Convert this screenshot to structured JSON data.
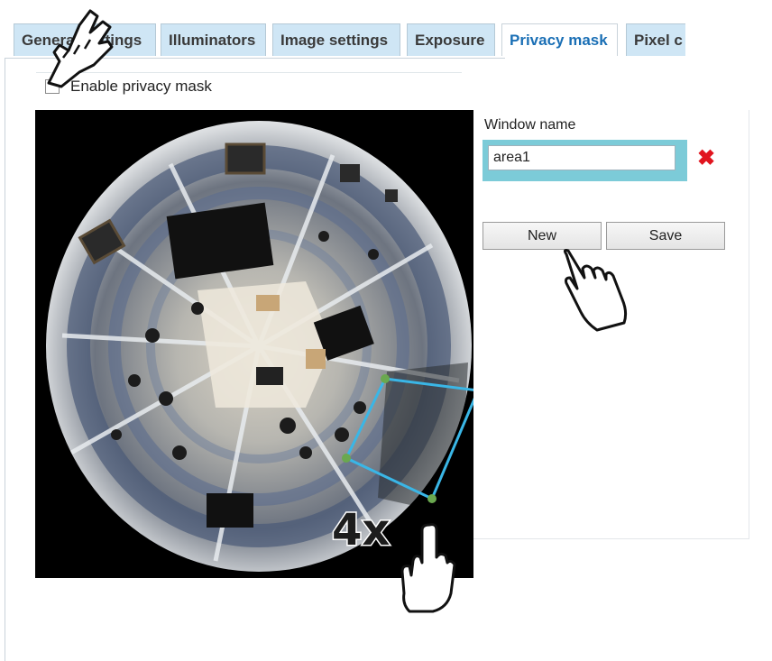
{
  "tabs": [
    {
      "label": "General settings",
      "active": false
    },
    {
      "label": "Illuminators",
      "active": false
    },
    {
      "label": "Image settings",
      "active": false
    },
    {
      "label": "Exposure",
      "active": false
    },
    {
      "label": "Privacy mask",
      "active": true
    },
    {
      "label": "Pixel c",
      "active": false
    }
  ],
  "privacy": {
    "enable_label": "Enable privacy mask",
    "enabled": false
  },
  "window": {
    "name_label": "Window name",
    "name_value": "area1",
    "delete_icon": "red-x-icon",
    "new_label": "New",
    "save_label": "Save"
  },
  "overlay": {
    "zoom_text": "4x",
    "mask_color": "#3ab6e6",
    "handle_color": "#6aa84f"
  },
  "colors": {
    "tab_bg": "#cfe6f5",
    "tab_active_text": "#1a6fb5",
    "input_frame": "#7ccbd8",
    "delete": "#e1141e"
  }
}
